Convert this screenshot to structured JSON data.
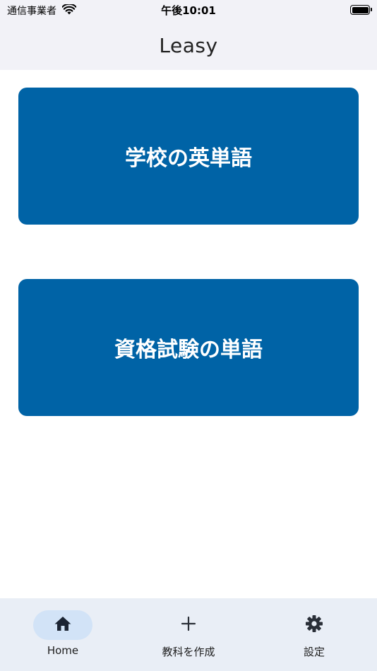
{
  "status_bar": {
    "carrier": "通信事業者",
    "time": "午後10:01"
  },
  "nav": {
    "title": "Leasy"
  },
  "cards": [
    {
      "label": "学校の英単語"
    },
    {
      "label": "資格試験の単語"
    }
  ],
  "tab_bar": {
    "items": [
      {
        "label": "Home",
        "icon": "home-icon",
        "active": true
      },
      {
        "label": "教科を作成",
        "icon": "plus-icon",
        "active": false
      },
      {
        "label": "設定",
        "icon": "gear-icon",
        "active": false
      }
    ]
  },
  "colors": {
    "card_background": "#0063a6",
    "tab_bar_background": "#e9eef6",
    "active_tab_pill": "#d2e3f7"
  }
}
